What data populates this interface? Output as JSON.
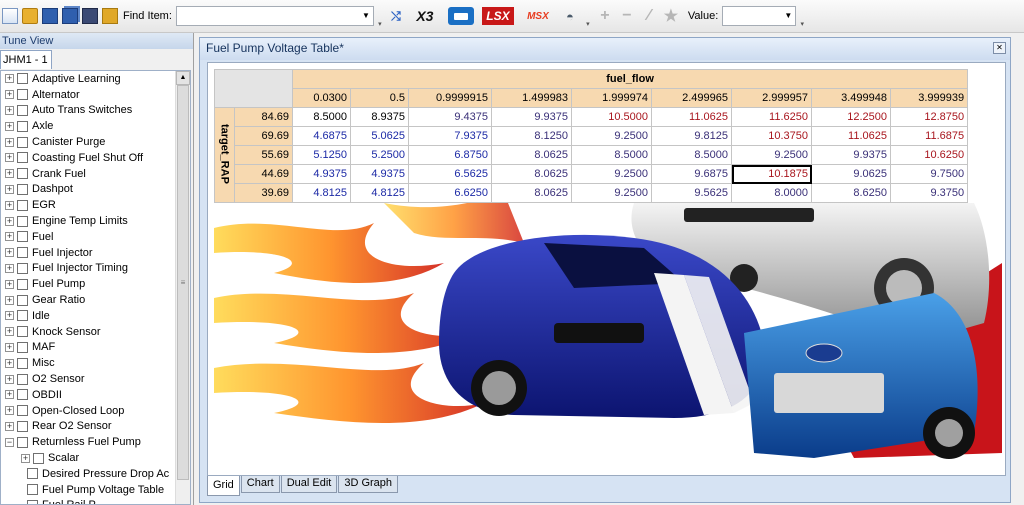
{
  "toolbar": {
    "find_label": "Find Item:",
    "find_value": "",
    "logo_x3": "X3",
    "logo_lsx": "LSX",
    "logo_msx": "MSX",
    "value_label": "Value:",
    "value_value": ""
  },
  "tree": {
    "header": "Tune View",
    "tab_label": "JHM1 - 1",
    "items": [
      {
        "label": "Adaptive Learning",
        "level": 0,
        "expander": "+"
      },
      {
        "label": "Alternator",
        "level": 0,
        "expander": "+"
      },
      {
        "label": "Auto Trans Switches",
        "level": 0,
        "expander": "+"
      },
      {
        "label": "Axle",
        "level": 0,
        "expander": "+"
      },
      {
        "label": "Canister Purge",
        "level": 0,
        "expander": "+"
      },
      {
        "label": "Coasting Fuel Shut Off",
        "level": 0,
        "expander": "+"
      },
      {
        "label": "Crank Fuel",
        "level": 0,
        "expander": "+"
      },
      {
        "label": "Dashpot",
        "level": 0,
        "expander": "+"
      },
      {
        "label": "EGR",
        "level": 0,
        "expander": "+"
      },
      {
        "label": "Engine Temp Limits",
        "level": 0,
        "expander": "+"
      },
      {
        "label": "Fuel",
        "level": 0,
        "expander": "+"
      },
      {
        "label": "Fuel Injector",
        "level": 0,
        "expander": "+"
      },
      {
        "label": "Fuel Injector Timing",
        "level": 0,
        "expander": "+"
      },
      {
        "label": "Fuel Pump",
        "level": 0,
        "expander": "+"
      },
      {
        "label": "Gear Ratio",
        "level": 0,
        "expander": "+"
      },
      {
        "label": "Idle",
        "level": 0,
        "expander": "+"
      },
      {
        "label": "Knock Sensor",
        "level": 0,
        "expander": "+"
      },
      {
        "label": "MAF",
        "level": 0,
        "expander": "+"
      },
      {
        "label": "Misc",
        "level": 0,
        "expander": "+"
      },
      {
        "label": "O2 Sensor",
        "level": 0,
        "expander": "+"
      },
      {
        "label": "OBDII",
        "level": 0,
        "expander": "+"
      },
      {
        "label": "Open-Closed Loop",
        "level": 0,
        "expander": "+"
      },
      {
        "label": "Rear O2 Sensor",
        "level": 0,
        "expander": "+"
      },
      {
        "label": "Returnless Fuel Pump",
        "level": 0,
        "expander": "−"
      },
      {
        "label": "Scalar",
        "level": 1,
        "expander": "+"
      },
      {
        "label": "Desired Pressure Drop Ac",
        "level": 1,
        "expander": ""
      },
      {
        "label": "Fuel Pump Voltage Table",
        "level": 1,
        "expander": ""
      },
      {
        "label": "Fuel Rail P",
        "level": 1,
        "expander": ""
      }
    ]
  },
  "table_window": {
    "title": "Fuel Pump Voltage Table*",
    "x_axis_label": "fuel_flow",
    "y_axis_label": "target_RAP",
    "columns": [
      "0.0300",
      "0.5",
      "0.9999915",
      "1.499983",
      "1.999974",
      "2.499965",
      "2.999957",
      "3.499948",
      "3.999939"
    ],
    "rows": [
      {
        "label": "84.69",
        "values": [
          "8.5000",
          "8.9375",
          "9.4375",
          "9.9375",
          "10.5000",
          "11.0625",
          "11.6250",
          "12.2500",
          "12.8750"
        ]
      },
      {
        "label": "69.69",
        "values": [
          "4.6875",
          "5.0625",
          "7.9375",
          "8.1250",
          "9.2500",
          "9.8125",
          "10.3750",
          "11.0625",
          "11.6875"
        ]
      },
      {
        "label": "55.69",
        "values": [
          "5.1250",
          "5.2500",
          "6.8750",
          "8.0625",
          "8.5000",
          "8.5000",
          "9.2500",
          "9.9375",
          "10.6250"
        ]
      },
      {
        "label": "44.69",
        "values": [
          "4.9375",
          "4.9375",
          "6.5625",
          "8.0625",
          "9.2500",
          "9.6875",
          "10.1875",
          "9.0625",
          "9.7500"
        ]
      },
      {
        "label": "39.69",
        "values": [
          "4.8125",
          "4.8125",
          "6.6250",
          "8.0625",
          "9.2500",
          "9.5625",
          "8.0000",
          "8.6250",
          "9.3750"
        ]
      }
    ],
    "tabs": [
      "Grid",
      "Chart",
      "Dual Edit",
      "3D Graph"
    ],
    "active_tab": "Grid"
  }
}
